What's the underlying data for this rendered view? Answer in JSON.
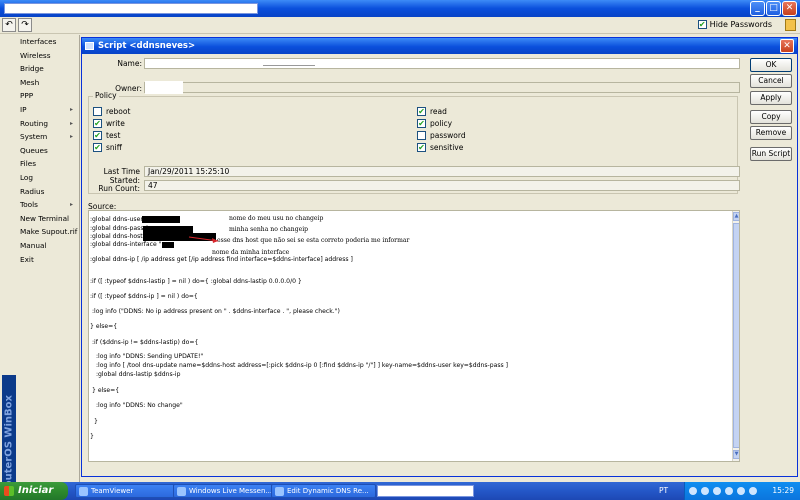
{
  "toolbar": {
    "hide_passwords_label": "Hide Passwords",
    "hide_passwords_checked": true
  },
  "menu": {
    "items": [
      {
        "label": "Interfaces",
        "submenu": false
      },
      {
        "label": "Wireless",
        "submenu": false
      },
      {
        "label": "Bridge",
        "submenu": false
      },
      {
        "label": "Mesh",
        "submenu": false
      },
      {
        "label": "PPP",
        "submenu": false
      },
      {
        "label": "IP",
        "submenu": true
      },
      {
        "label": "Routing",
        "submenu": true
      },
      {
        "label": "System",
        "submenu": true
      },
      {
        "label": "Queues",
        "submenu": false
      },
      {
        "label": "Files",
        "submenu": false
      },
      {
        "label": "Log",
        "submenu": false
      },
      {
        "label": "Radius",
        "submenu": false
      },
      {
        "label": "Tools",
        "submenu": true
      },
      {
        "label": "New Terminal",
        "submenu": false
      },
      {
        "label": "Make Supout.rif",
        "submenu": false
      },
      {
        "label": "Manual",
        "submenu": false
      },
      {
        "label": "Exit",
        "submenu": false
      }
    ],
    "brand": "RouterOS WinBox"
  },
  "window": {
    "title": "Script <ddnsneves>",
    "name_label": "Name:",
    "owner_label": "Owner:",
    "policy_label": "Policy",
    "policies": [
      {
        "label": "reboot",
        "checked": false
      },
      {
        "label": "read",
        "checked": true
      },
      {
        "label": "write",
        "checked": true
      },
      {
        "label": "policy",
        "checked": true
      },
      {
        "label": "test",
        "checked": true
      },
      {
        "label": "password",
        "checked": false
      },
      {
        "label": "sniff",
        "checked": true
      },
      {
        "label": "sensitive",
        "checked": true
      }
    ],
    "last_time_label": "Last Time Started:",
    "last_time_value": "Jan/29/2011 15:25:10",
    "run_count_label": "Run Count:",
    "run_count_value": "47",
    "source_label": "Source:",
    "buttons": {
      "ok": "OK",
      "cancel": "Cancel",
      "apply": "Apply",
      "copy": "Copy",
      "remove": "Remove",
      "run_script": "Run Script"
    },
    "source_lines": [
      ":global ddns-user \"",
      ":global ddns-pass \"",
      ":global ddns-host \"",
      ":global ddns-interface \"",
      ":global ddns-ip [ /ip address get [/ip address find interface=$ddns-interface] address ]",
      ":if ([ :typeof $ddns-lastip ] = nil ) do={ :global ddns-lastip 0.0.0.0/0 }",
      ":if ([ :typeof $ddns-ip ] = nil ) do={",
      ":log info (\"DDNS: No ip address present on \" . $ddns-interface . \", please check.\")",
      "} else={",
      ":if ($ddns-ip != $ddns-lastip) do={",
      ":log info \"DDNS: Sending UPDATE!\"",
      ":log info [ /tool dns-update name=$ddns-host address=[:pick $ddns-ip 0 [:find $ddns-ip \"/\"] ] key-name=$ddns-user key=$ddns-pass ]",
      ":global ddns-lastip $ddns-ip",
      "} else={",
      ":log info \"DDNS: No change\"",
      "}",
      "}"
    ],
    "annotations": {
      "user": "nome do meu usu no changeip",
      "pass": "minha senha no changeip",
      "host": "esse dns host que não sei se esta correto poderia me informar",
      "interface": "nome da minha interface"
    }
  },
  "taskbar": {
    "start_label": "Iniciar",
    "tasks": [
      {
        "label": "TeamViewer",
        "active": false
      },
      {
        "label": "Windows Live Messen...",
        "active": false
      },
      {
        "label": "Edit Dynamic DNS Re...",
        "active": false
      }
    ],
    "language": "PT",
    "clock": "15:29"
  },
  "colors": {
    "xp_blue": "#0a4fdc",
    "check_green": "#21a121",
    "annotation_red": "#d8262b"
  }
}
